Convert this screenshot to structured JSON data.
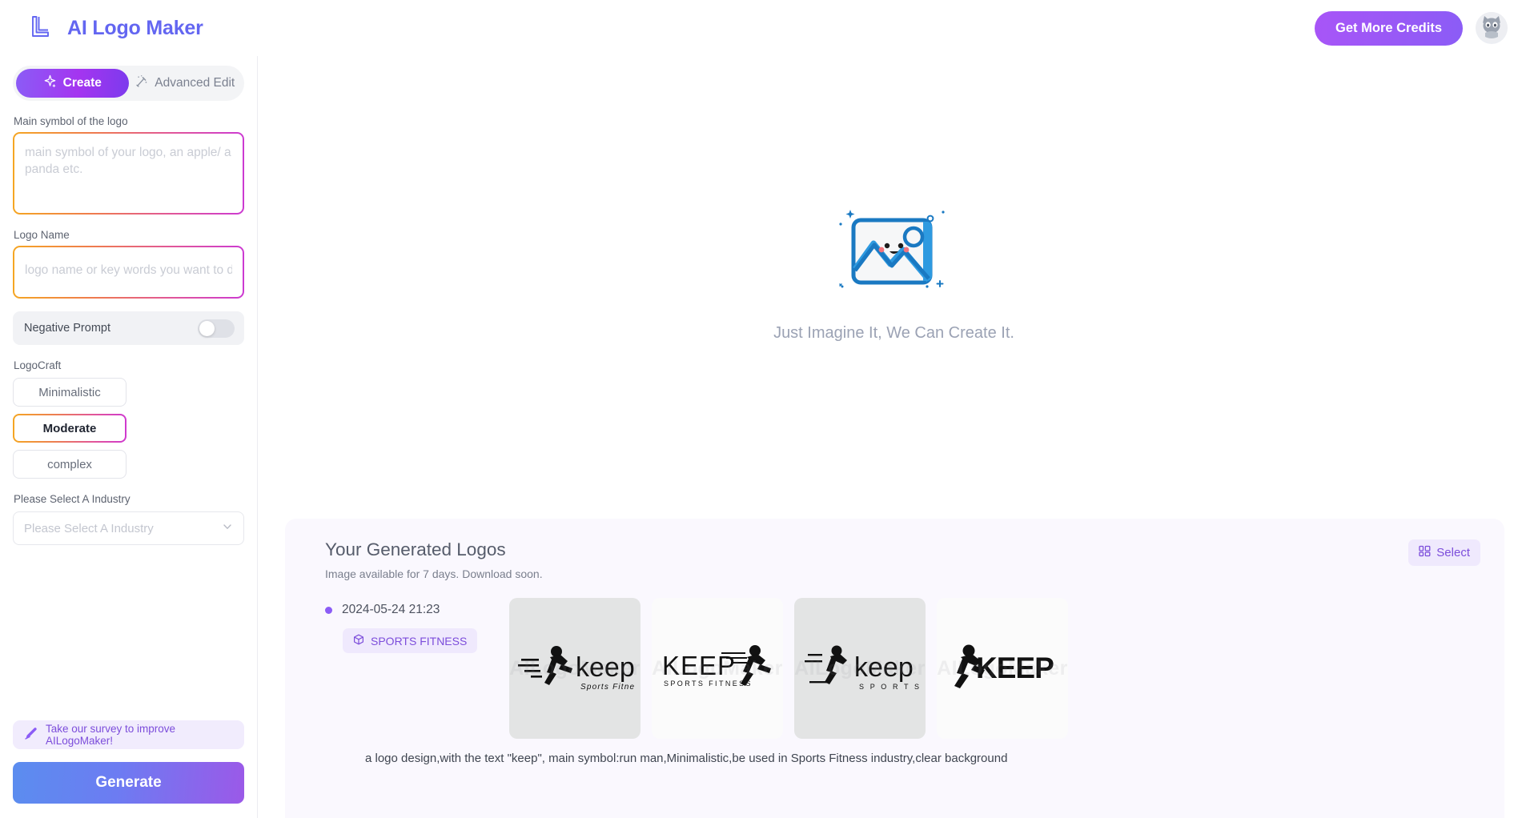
{
  "header": {
    "brand_title": "AI Logo Maker",
    "brand_icon": "logo-l-mark-icon",
    "credits_button": "Get More Credits",
    "avatar_icon": "user-avatar-cat-icon"
  },
  "sidebar": {
    "tabs": [
      {
        "label": "Create",
        "icon": "sparkle-icon",
        "active": true
      },
      {
        "label": "Advanced Edit",
        "icon": "magic-wand-icon",
        "active": false
      }
    ],
    "main_symbol": {
      "label": "Main symbol of the logo",
      "placeholder": "main symbol of your logo, an apple/ a panda etc.",
      "value": ""
    },
    "logo_name": {
      "label": "Logo Name",
      "placeholder": "logo name or key words you want to display",
      "value": ""
    },
    "negative_prompt": {
      "label": "Negative Prompt",
      "enabled": false
    },
    "logocraft": {
      "label": "LogoCraft",
      "options": [
        {
          "label": "Minimalistic",
          "selected": false
        },
        {
          "label": "Moderate",
          "selected": true
        },
        {
          "label": "complex",
          "selected": false
        }
      ]
    },
    "industry": {
      "label": "Please Select A Industry",
      "placeholder": "Please Select A Industry",
      "value": "",
      "chevron": "chevron-down-icon"
    },
    "survey": {
      "text": "Take our survey to improve AILogoMaker!",
      "icon": "survey-pen-icon"
    },
    "generate_button": "Generate"
  },
  "main": {
    "empty_state": {
      "icon": "image-placeholder-smiley-icon",
      "caption": "Just Imagine It, We Can Create It."
    },
    "results": {
      "title": "Your Generated Logos",
      "subtitle": "Image available for 7 days. Download soon.",
      "select_button": {
        "label": "Select",
        "icon": "grid-select-icon"
      },
      "rows": [
        {
          "timestamp": "2024-05-24 21:23",
          "industry_tag": {
            "label": "SPORTS FITNESS",
            "icon": "cube-icon"
          },
          "watermark": "AILogoMaker",
          "thumbnails": [
            {
              "name": "keep",
              "tagline": "Sports Fitness",
              "style": "gray",
              "case": "lower"
            },
            {
              "name": "KEEP",
              "tagline": "SPORTS FITNESS",
              "style": "light",
              "case": "upper"
            },
            {
              "name": "keep",
              "tagline": "S P O R T S",
              "style": "gray",
              "case": "lower"
            },
            {
              "name": "KEEP",
              "tagline": "",
              "style": "light",
              "case": "upper"
            }
          ],
          "prompt": "a logo design,with the text \"keep\", main symbol:run man,Minimalistic,be used in Sports Fitness industry,clear background"
        }
      ]
    }
  },
  "colors": {
    "brand_purple": "#6366f1",
    "accent_purple": "#8b5cf6",
    "gradient_orange": "#f5a623",
    "gradient_magenta": "#cc3ad2",
    "panel_bg": "#faf8fe"
  }
}
